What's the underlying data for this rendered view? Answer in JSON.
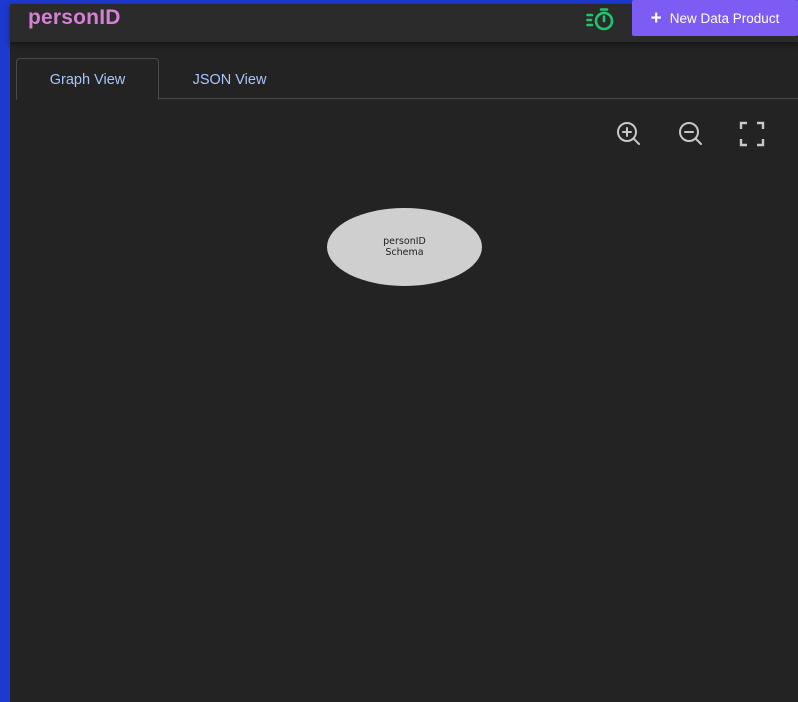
{
  "header": {
    "title": "personID",
    "timer_icon": "timer-icon",
    "new_button_label": "New Data Product",
    "accent_title_color": "#d57fd5",
    "accent_button_color": "#7c5cf2",
    "timer_color": "#1fc46b"
  },
  "tabs": [
    {
      "label": "Graph View",
      "active": true
    },
    {
      "label": "JSON View",
      "active": false
    }
  ],
  "graph": {
    "controls": [
      "zoom-in-icon",
      "zoom-out-icon",
      "fit-screen-icon"
    ],
    "nodes": [
      {
        "line1": "personID",
        "line2": "Schema"
      }
    ]
  }
}
